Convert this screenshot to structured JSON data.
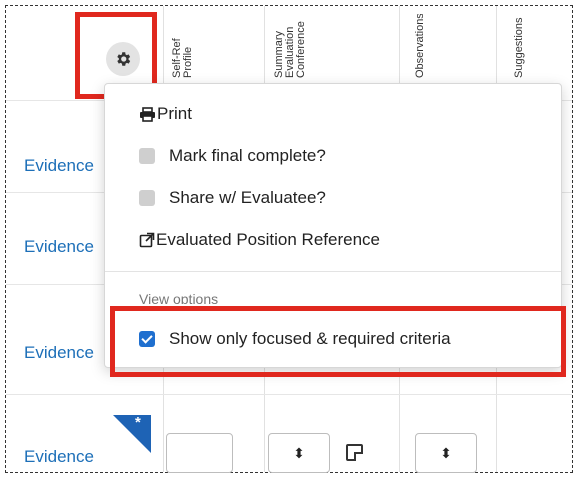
{
  "table": {
    "column_headers": [
      "Self-Ref\nProfile",
      "Summary\nEvaluation\nConference",
      "Observations",
      "Suggestions"
    ],
    "rows": [
      {
        "evidence_label": "Evidence"
      },
      {
        "evidence_label": "Evidence"
      },
      {
        "evidence_label": "Evidence"
      },
      {
        "evidence_label": "Evidence"
      }
    ],
    "required_marker": "*",
    "stepper_symbol": "⬍"
  },
  "settings_button": {
    "icon": "gear-icon"
  },
  "menu": {
    "items": [
      {
        "label": "Print",
        "icon": "print-icon"
      },
      {
        "label": "Mark final complete?",
        "checked": false
      },
      {
        "label": "Share w/ Evaluatee?",
        "checked": false
      },
      {
        "label": "Evaluated Position Reference",
        "icon": "external-link-icon"
      }
    ],
    "section_label": "View options",
    "view_option": {
      "label": "Show only focused & required criteria",
      "checked": true
    }
  },
  "colors": {
    "link": "#1d6fb8",
    "highlight": "#e0281e",
    "checkbox_checked": "#1f6fcf",
    "marker": "#1e63b5"
  }
}
